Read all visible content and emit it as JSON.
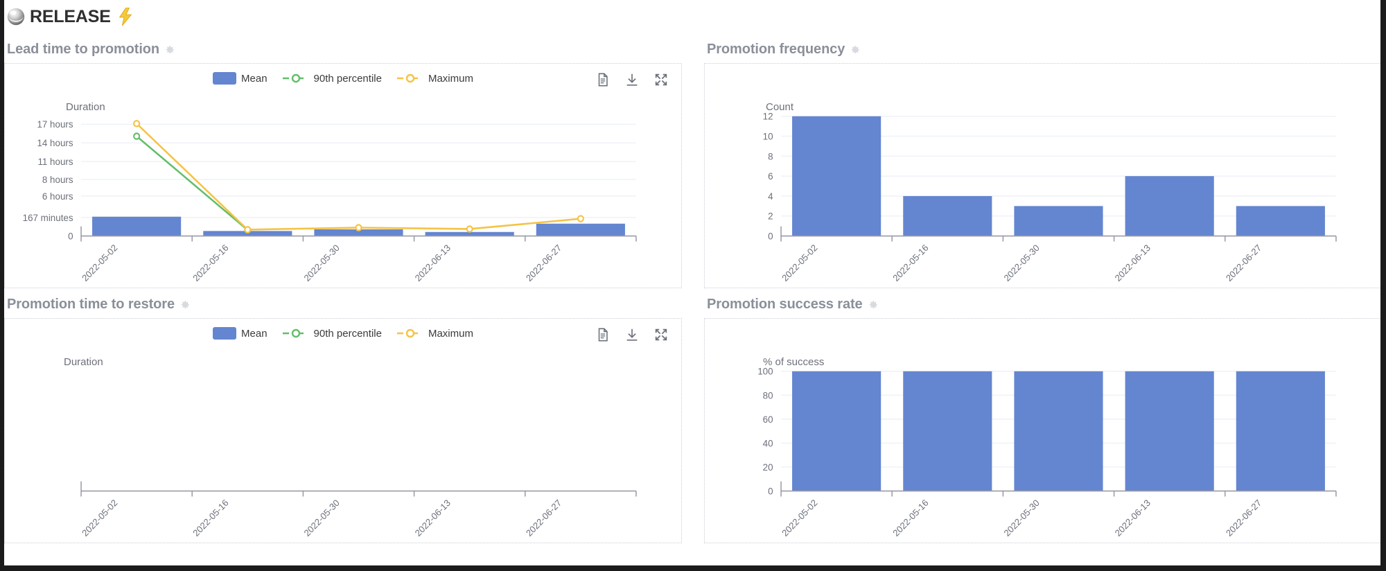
{
  "header": {
    "brand": "RELEASE",
    "sphere_icon": "sphere-icon",
    "bolt_icon": "lightning-bolt-icon"
  },
  "colors": {
    "bar": "#6485d0",
    "mean": "#6485d0",
    "p90": "#63be6a",
    "maximum": "#f5c344",
    "grid": "#edf1f7",
    "axis": "#9a9aa6",
    "title": "#8a8f99"
  },
  "toolbar": {
    "items": [
      {
        "name": "view-data-icon",
        "label": "View data"
      },
      {
        "name": "download-icon",
        "label": "Download"
      },
      {
        "name": "fullscreen-icon",
        "label": "Fullscreen"
      }
    ]
  },
  "legend": {
    "items": [
      {
        "label": "Mean",
        "type": "bar",
        "color": "#6485d0"
      },
      {
        "label": "90th percentile",
        "type": "line",
        "color": "#63be6a"
      },
      {
        "label": "Maximum",
        "type": "line",
        "color": "#f5c344"
      }
    ]
  },
  "panels": [
    {
      "id": "lead-time-to-promotion",
      "title": "Lead time to promotion",
      "settings_icon": "gear-icon",
      "has_legend": true,
      "has_toolbar": true
    },
    {
      "id": "promotion-frequency",
      "title": "Promotion frequency",
      "settings_icon": "gear-icon",
      "has_legend": false,
      "has_toolbar": false
    },
    {
      "id": "promotion-time-to-restore",
      "title": "Promotion time to restore",
      "settings_icon": "gear-icon",
      "has_legend": true,
      "has_toolbar": true
    },
    {
      "id": "promotion-success-rate",
      "title": "Promotion success rate",
      "settings_icon": "gear-icon",
      "has_legend": false,
      "has_toolbar": false
    }
  ],
  "chart_data": [
    {
      "id": "lead-time-to-promotion",
      "type": "bar",
      "title": "Lead time to promotion",
      "xlabel": "",
      "ylabel": "Duration",
      "categories": [
        "2022-05-02",
        "2022-05-16",
        "2022-05-30",
        "2022-06-13",
        "2022-06-27"
      ],
      "ytick_labels": [
        "0",
        "167 minutes",
        "6 hours",
        "8 hours",
        "11 hours",
        "14 hours",
        "17 hours"
      ],
      "ytick_values": [
        0,
        2.78,
        6,
        8.5,
        11.2,
        14,
        16.8
      ],
      "ylim": [
        0,
        18
      ],
      "grid": true,
      "legend_position": "top-center",
      "series": [
        {
          "name": "Mean",
          "kind": "bar",
          "color": "#6485d0",
          "values": [
            2.9,
            0.75,
            1.0,
            0.6,
            1.85
          ]
        },
        {
          "name": "90th percentile",
          "kind": "line",
          "color": "#63be6a",
          "values": [
            15.0,
            0.9,
            null,
            null,
            null
          ]
        },
        {
          "name": "Maximum",
          "kind": "line",
          "color": "#f5c344",
          "values": [
            16.9,
            0.95,
            1.25,
            1.05,
            2.6
          ]
        }
      ]
    },
    {
      "id": "promotion-frequency",
      "type": "bar",
      "title": "Promotion frequency",
      "xlabel": "",
      "ylabel": "Count",
      "categories": [
        "2022-05-02",
        "2022-05-16",
        "2022-05-30",
        "2022-06-13",
        "2022-06-27"
      ],
      "ytick_labels": [
        "0",
        "2",
        "4",
        "6",
        "8",
        "10",
        "12"
      ],
      "ytick_values": [
        0,
        2,
        4,
        6,
        8,
        10,
        12
      ],
      "ylim": [
        0,
        12
      ],
      "grid": true,
      "values": [
        12,
        4,
        3,
        6,
        3
      ],
      "bar_color": "#6485d0"
    },
    {
      "id": "promotion-time-to-restore",
      "type": "bar",
      "title": "Promotion time to restore",
      "xlabel": "",
      "ylabel": "Duration",
      "categories": [
        "2022-05-02",
        "2022-05-16",
        "2022-05-30",
        "2022-06-13",
        "2022-06-27"
      ],
      "ytick_labels": [],
      "ytick_values": [],
      "ylim": [
        0,
        1
      ],
      "grid": false,
      "empty": true,
      "series": [
        {
          "name": "Mean",
          "kind": "bar",
          "color": "#6485d0",
          "values": []
        },
        {
          "name": "90th percentile",
          "kind": "line",
          "color": "#63be6a",
          "values": []
        },
        {
          "name": "Maximum",
          "kind": "line",
          "color": "#f5c344",
          "values": []
        }
      ]
    },
    {
      "id": "promotion-success-rate",
      "type": "bar",
      "title": "Promotion success rate",
      "xlabel": "",
      "ylabel": "% of success",
      "categories": [
        "2022-05-02",
        "2022-05-16",
        "2022-05-30",
        "2022-06-13",
        "2022-06-27"
      ],
      "ytick_labels": [
        "0",
        "20",
        "40",
        "60",
        "80",
        "100"
      ],
      "ytick_values": [
        0,
        20,
        40,
        60,
        80,
        100
      ],
      "ylim": [
        0,
        100
      ],
      "grid": true,
      "values": [
        100,
        100,
        100,
        100,
        100
      ],
      "bar_color": "#6485d0"
    }
  ]
}
